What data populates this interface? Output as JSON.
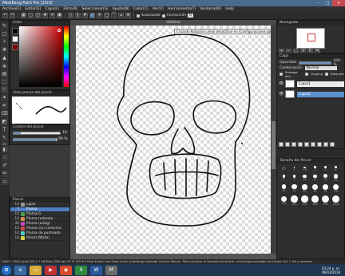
{
  "window": {
    "title": "MediBang Paint Pro [23rd]"
  },
  "menu": [
    "Archivo(F)",
    "Editar(E)",
    "Capa(L)",
    "Filtro(R)",
    "Seleccionar(S)",
    "Ajuste(N)",
    "Color(C)",
    "Ver(V)",
    "Herramienta(T)",
    "Ventana(W)",
    "Help"
  ],
  "toolbar": {
    "suavizado_label": "Suavizado",
    "correccion_label": "Corrección",
    "correccion_value": "0"
  },
  "canvas": {
    "title": "Untitled",
    "tooltip": "Cruzado Rotación Lineal desactivar en [Configuraciones generales]"
  },
  "panels": {
    "color": "Color",
    "brush_preview": "Vista previa del pincel",
    "brush_control": "Control del pincel",
    "brush": "Pincel",
    "navigator": "Navegador",
    "layer": "Capa",
    "size_palette": "Tamaño del Pincel"
  },
  "brush_size": {
    "value": "10",
    "opacity": "99 %"
  },
  "brushes": [
    {
      "num": "10",
      "name": "Lápiz",
      "color": "#9a9a9a"
    },
    {
      "num": "5",
      "name": "Pluma",
      "color": "#4a7fd0"
    },
    {
      "num": "10",
      "name": "Pluma G",
      "color": "#4aa04a"
    },
    {
      "num": "10",
      "name": "Pluma redonda",
      "color": "#d0904a"
    },
    {
      "num": "40",
      "name": "Pluma (antig)",
      "color": "#c04ac0"
    },
    {
      "num": "10",
      "name": "Pluma con contorno",
      "color": "#d04a4a"
    },
    {
      "num": "10",
      "name": "Pluma de punteado",
      "color": "#4ad0d0"
    },
    {
      "num": "10",
      "name": "Pincel (Wata)",
      "color": "#d0d04a"
    }
  ],
  "layers": {
    "opacity_label": "Opacidad",
    "opacity_value": "100 %",
    "blend_label": "Combinación",
    "blend_value": "Normal",
    "protect_label": "Proteger alfa",
    "clip_label": "Clipping",
    "lock_label": "Bloquear",
    "items": [
      {
        "name": "Capa1",
        "selected": false
      },
      {
        "name": "Capa2",
        "selected": true
      }
    ]
  },
  "size_palette": {
    "sizes": [
      "0.7",
      "1",
      "1.5",
      "2",
      "3",
      "4",
      "5",
      "7",
      "10",
      "12",
      "15",
      "20",
      "25",
      "30",
      "40",
      "50",
      "70",
      "100",
      "150",
      "200",
      "300",
      "400",
      "500",
      "1000"
    ]
  },
  "statusbar": "2400 * 1500 pixel (22.1 * 18.8cm) 300 dpi 15 % (55.4*) Para trazar una línea recta, mantenga pulsada la tecla Mayús. Para cambiar el tamaño del pincel, mantenga pulsadas las teclas Ctrl + Alt y arrastre.",
  "taskbar": {
    "time": "03:24 p. m.",
    "date": "06/01/2018",
    "lang": "ES"
  }
}
